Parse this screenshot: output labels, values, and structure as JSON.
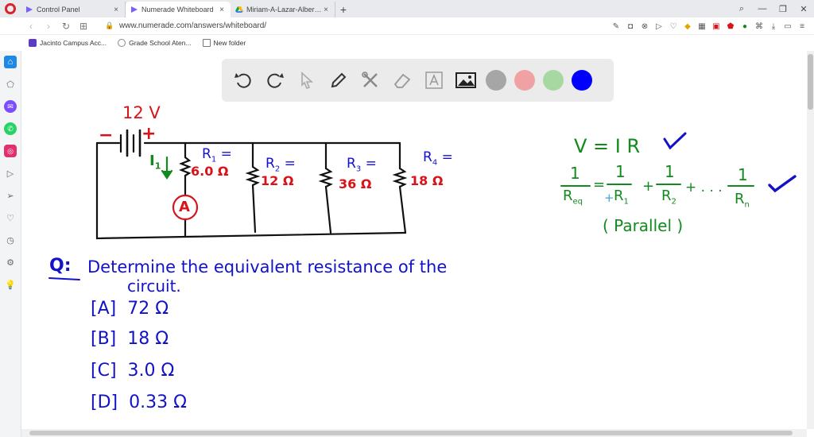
{
  "tabs": [
    {
      "label": "Control Panel",
      "active": false
    },
    {
      "label": "Numerade Whiteboard",
      "active": true
    },
    {
      "label": "Miriam-A-Lazar-Albert-Tar",
      "active": false
    }
  ],
  "address": {
    "url": "www.numerade.com/answers/whiteboard/"
  },
  "bookmarks": [
    {
      "label": "Jacinto Campus Acc..."
    },
    {
      "label": "Grade School Aten..."
    },
    {
      "label": "New folder"
    }
  ],
  "colors": {
    "red": "#d7141a",
    "green": "#128a1d",
    "blue": "#1212c8",
    "toolbar_bg": "#ebebeb"
  },
  "toolbar": {
    "tools": [
      "undo-icon",
      "redo-icon",
      "pointer-icon",
      "pen-icon",
      "tools-icon",
      "eraser-icon",
      "text-icon",
      "image-icon"
    ],
    "swatches": [
      "#a6a6a6",
      "#f0a1a4",
      "#a8d8a2",
      "#0000ff"
    ]
  },
  "board": {
    "circuit": {
      "voltage": "12 V",
      "minus": "−",
      "plus": "+",
      "current": "I",
      "current_sub": "1",
      "ammeter": "A",
      "r1_label": "R",
      "r1_sub": "1",
      "r1_value": "6.0 Ω",
      "r2_label": "R",
      "r2_sub": "2",
      "r2_value": "12 Ω",
      "r3_label": "R",
      "r3_sub": "3",
      "r3_value": "36 Ω",
      "r4_label": "R",
      "r4_sub": "4",
      "r4_value": "18 Ω",
      "eq": "="
    },
    "formulas": {
      "ohm": "V = I R",
      "one": "1",
      "req": "R",
      "req_sub": "eq",
      "r1": "R",
      "r1_sub": "1",
      "r2": "R",
      "r2_sub": "2",
      "rn": "R",
      "rn_sub": "n",
      "plus": "+",
      "eq": "=",
      "dots": "+ . . .",
      "parallel": "( Parallel )"
    },
    "question": {
      "q": "Q:",
      "line1": "Determine the equivalent resistance of the",
      "line2": "circuit.",
      "options": [
        {
          "letter": "[A]",
          "text": "72 Ω"
        },
        {
          "letter": "[B]",
          "text": "18 Ω"
        },
        {
          "letter": "[C]",
          "text": "3.0 Ω"
        },
        {
          "letter": "[D]",
          "text": "0.33 Ω"
        }
      ]
    }
  }
}
